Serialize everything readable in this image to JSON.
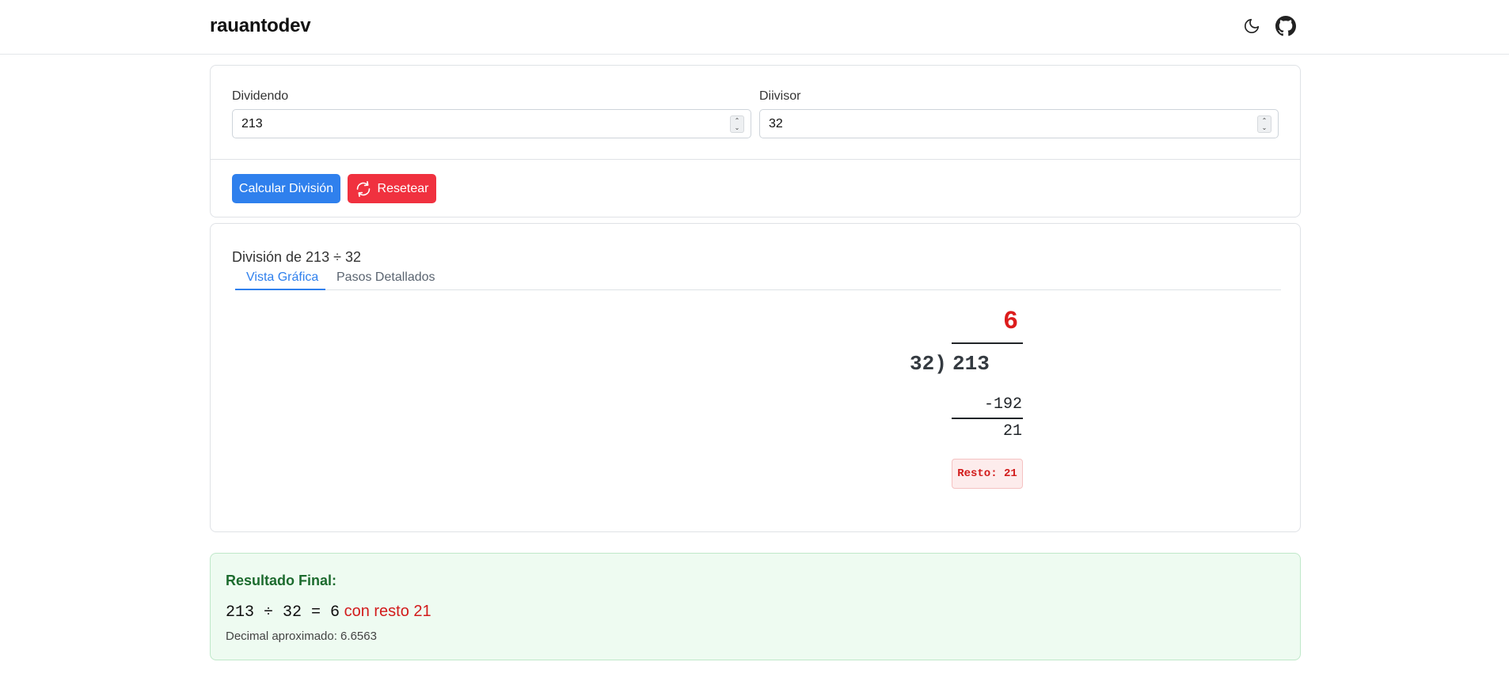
{
  "navbar": {
    "brand": "rauantodev",
    "icons": [
      "moon-icon",
      "github-icon"
    ]
  },
  "form": {
    "dividend_label": "Dividendo",
    "dividend_value": "213",
    "divisor_label": "Diivisor",
    "divisor_value": "32",
    "calc_button": "Calcular División",
    "reset_button": "Resetear"
  },
  "result": {
    "title": "División de 213 ÷ 32",
    "tabs": [
      "Vista Gráfica",
      "Pasos Detallados"
    ],
    "quotient": "6",
    "divisor_display": "32)",
    "dividend_display": "213",
    "subtract": "-192",
    "remainder": "21",
    "resto_badge": "Resto: 21"
  },
  "final": {
    "title": "Resultado Final:",
    "equation": "213 ÷ 32 = 6",
    "remainder_text": "con resto 21",
    "decimal": "Decimal aproximado: 6.6563"
  },
  "colors": {
    "primary": "#2f80ed",
    "danger": "#f0313f",
    "quotient": "#dc1c1c",
    "success_bg": "#eefbf1",
    "success_title": "#1c6b2e"
  }
}
